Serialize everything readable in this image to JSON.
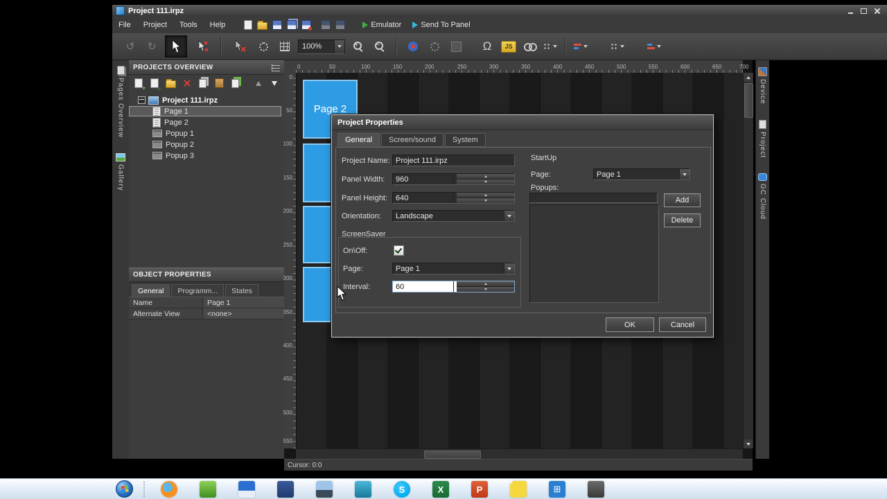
{
  "window": {
    "title": "Project 111.irpz"
  },
  "menubar": {
    "items": [
      "File",
      "Project",
      "Tools",
      "Help"
    ],
    "emulator_label": "Emulator",
    "send_label": "Send To Panel"
  },
  "toolbar": {
    "zoom_value": "100%",
    "omega": "Ω",
    "js": "JS"
  },
  "left_strip": {
    "pages_overview": "Pages Overview",
    "gallery": "Gallery"
  },
  "projects_panel": {
    "title": "PROJECTS OVERVIEW",
    "root": "Project 111.irpz",
    "items": [
      "Page 1",
      "Page 2",
      "Popup 1",
      "Popup 2",
      "Popup 3"
    ]
  },
  "object_panel": {
    "title": "OBJECT PROPERTIES",
    "tabs": [
      "General",
      "Programm...",
      "States"
    ],
    "rows": [
      {
        "k": "Name",
        "v": "Page 1"
      },
      {
        "k": "Alternate View",
        "v": "<none>"
      }
    ]
  },
  "canvas": {
    "tile_label": "Page 2",
    "hruler": [
      "0",
      "50",
      "100",
      "150",
      "200",
      "250",
      "300",
      "350",
      "400",
      "450",
      "500",
      "550",
      "600",
      "650",
      "700"
    ],
    "vruler": [
      "0",
      "50",
      "100",
      "150",
      "200",
      "250",
      "300",
      "350",
      "400",
      "450",
      "500",
      "550"
    ]
  },
  "dialog": {
    "title": "Project Properties",
    "tabs": [
      "General",
      "Screen/sound",
      "System"
    ],
    "project_name_label": "Project Name:",
    "project_name": "Project 111.irpz",
    "panel_width_label": "Panel Width:",
    "panel_width": "960",
    "panel_height_label": "Panel Height:",
    "panel_height": "640",
    "orientation_label": "Orientation:",
    "orientation": "Landscape",
    "screensaver_label": "ScreenSaver",
    "onoff_label": "On\\Off:",
    "page_label": "Page:",
    "screensaver_page": "Page 1",
    "interval_label": "Interval:",
    "interval": "60",
    "startup_label": "StartUp",
    "startup_page_label": "Page:",
    "startup_page": "Page 1",
    "popups_label": "Popups:",
    "add_label": "Add",
    "delete_label": "Delete",
    "ok_label": "OK",
    "cancel_label": "Cancel"
  },
  "right_strip": {
    "items": [
      "Device",
      "Project",
      "GC Cloud"
    ]
  },
  "statusbar": {
    "cursor": "Cursor: 0:0"
  },
  "taskbar": {
    "icons": [
      "start",
      "firefox",
      "green-app",
      "floppy-app",
      "blue-app",
      "monitor-app",
      "teal-app",
      "skype",
      "excel",
      "powerpoint",
      "sticky-notes",
      "blue-grid-app",
      "phone-app"
    ]
  }
}
